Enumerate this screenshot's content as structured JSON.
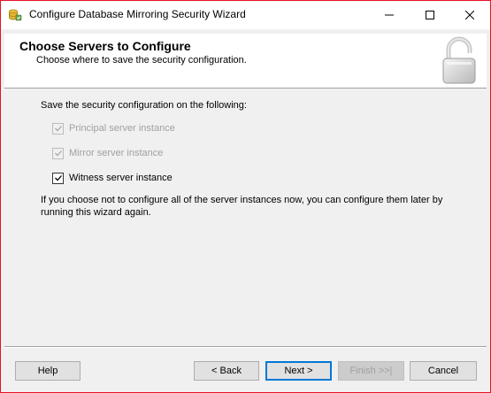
{
  "window": {
    "title": "Configure Database Mirroring Security Wizard",
    "accent_border_color": "#e81123",
    "icons": [
      "database-wizard-icon",
      "minimize-icon",
      "maximize-icon",
      "close-icon"
    ]
  },
  "header": {
    "title": "Choose Servers to Configure",
    "subtitle": "Choose where to save the security configuration.",
    "icon": "padlock-icon"
  },
  "content": {
    "intro": "Save the security configuration on the following:",
    "options": [
      {
        "label": "Principal server instance",
        "checked": true,
        "enabled": false
      },
      {
        "label": "Mirror server instance",
        "checked": true,
        "enabled": false
      },
      {
        "label": "Witness server instance",
        "checked": true,
        "enabled": true
      }
    ],
    "note": "If you choose not to configure all of the server instances now, you can configure them later by running this wizard again."
  },
  "buttons": {
    "help": "Help",
    "back": "< Back",
    "next": "Next >",
    "finish": "Finish >>|",
    "cancel": "Cancel"
  }
}
